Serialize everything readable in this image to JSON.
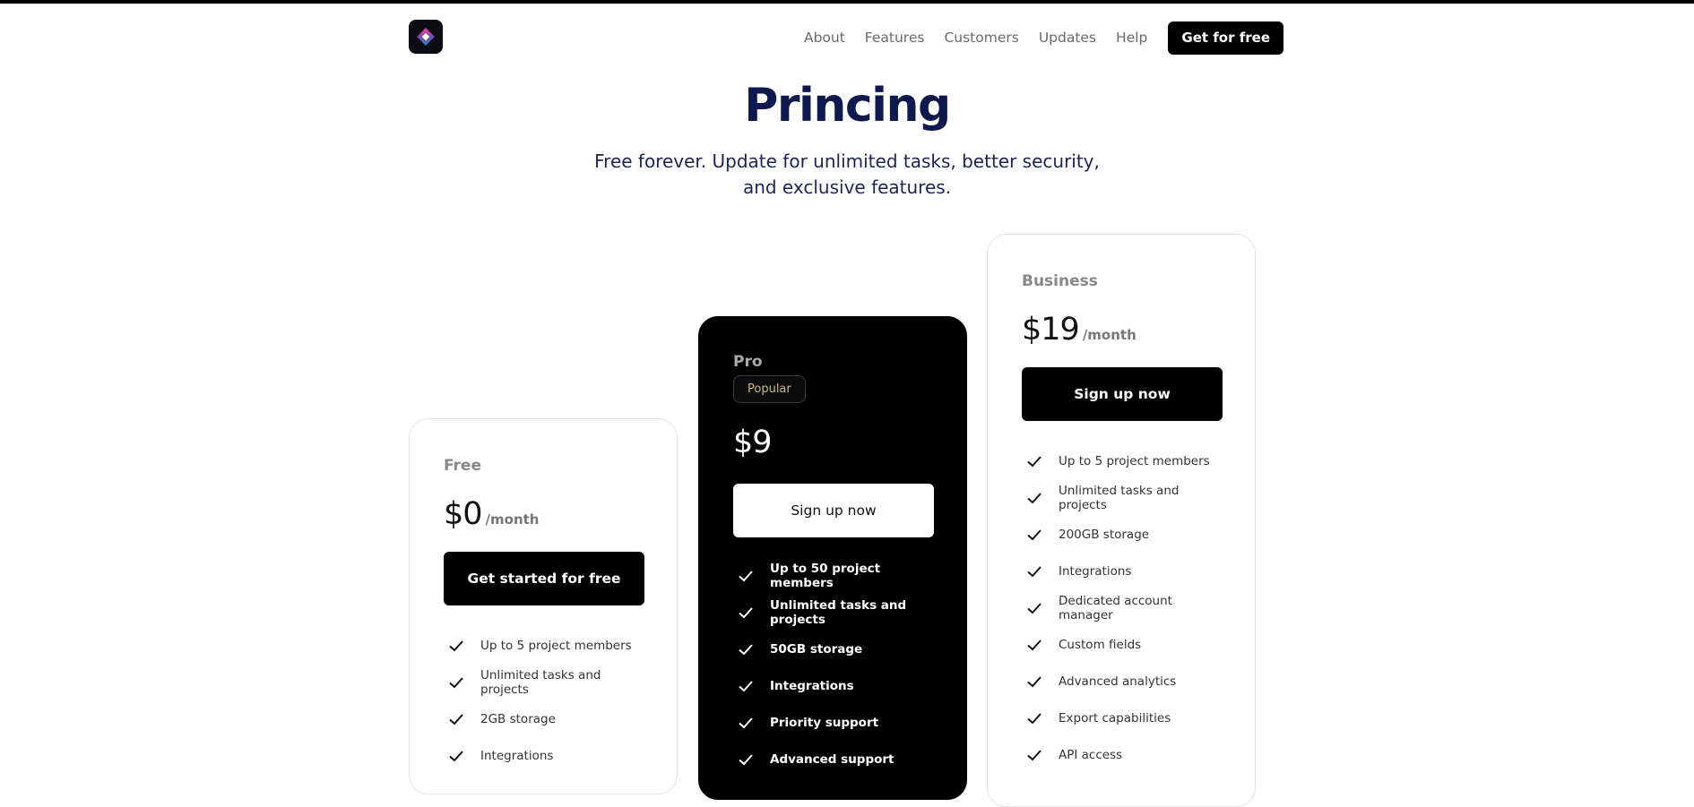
{
  "nav": {
    "links": [
      "About",
      "Features",
      "Customers",
      "Updates",
      "Help"
    ],
    "cta": "Get for free"
  },
  "hero": {
    "title": "Princing",
    "subtitle_line1": "Free forever. Update for unlimited tasks, better security,",
    "subtitle_line2": "and exclusive features."
  },
  "plans": {
    "free": {
      "name": "Free",
      "price": "$0",
      "period": "/month",
      "cta": "Get started for free",
      "features": [
        "Up to 5 project members",
        "Unlimited tasks and projects",
        "2GB storage",
        "Integrations"
      ]
    },
    "pro": {
      "name": "Pro",
      "badge": "Popular",
      "price": "$9",
      "cta": "Sign up now",
      "features": [
        "Up to 50 project members",
        "Unlimited tasks and projects",
        "50GB storage",
        "Integrations",
        "Priority support",
        "Advanced support"
      ]
    },
    "business": {
      "name": "Business",
      "price": "$19",
      "period": "/month",
      "cta": "Sign up now",
      "features": [
        "Up to 5 project members",
        "Unlimited tasks and projects",
        "200GB storage",
        "Integrations",
        "Dedicated account manager",
        "Custom fields",
        "Advanced analytics",
        "Export capabilities",
        "API access"
      ]
    }
  },
  "colors": {
    "title": "#0e1a4d",
    "accent_dark": "#000000",
    "badge_text": "#c9b98a"
  }
}
